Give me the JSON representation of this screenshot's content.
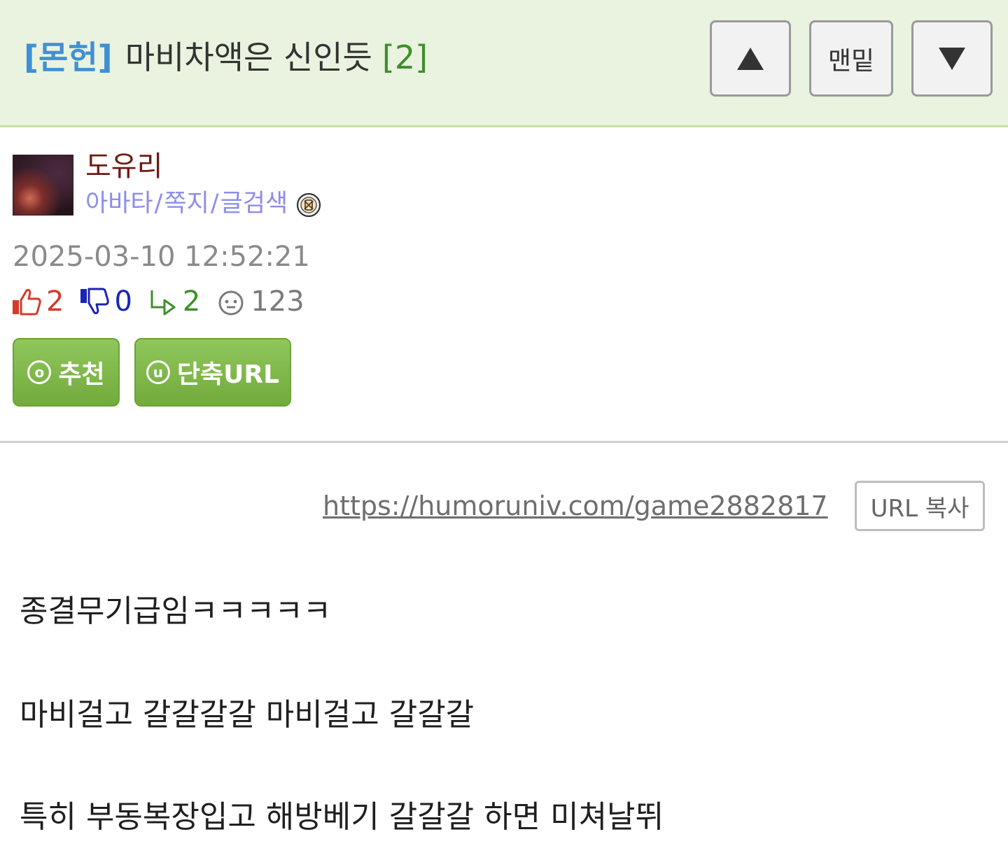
{
  "header": {
    "category": "[몬헌]",
    "subject": "마비차액은 신인듯",
    "comment_count": "[2]",
    "nav_bottom_label": "맨밑",
    "nav_up_icon": "triangle-up-icon",
    "nav_down_icon": "triangle-down-icon"
  },
  "author": {
    "nickname": "도유리",
    "links": {
      "avatar": "아바타",
      "message": "쪽지",
      "search": "글검색",
      "separator": "/"
    },
    "level_icon": "level-badge-icon"
  },
  "post": {
    "datetime": "2025-03-10 12:52:21",
    "stats": {
      "upvotes": "2",
      "downvotes": "0",
      "replies": "2",
      "views": "123"
    },
    "buttons": {
      "recommend": "추천",
      "recommend_icon": "ⓞ",
      "short_url": "단축URL",
      "short_url_icon": "ⓤ"
    },
    "url": "https://humoruniv.com/game2882817",
    "copy_label": "URL 복사",
    "content": [
      "종결무기급임ㅋㅋㅋㅋㅋ",
      "마비걸고 갈갈갈갈 마비걸고 갈갈갈",
      "특히 부동복장입고 해방베기 갈갈갈 하면 미쳐날뛰"
    ]
  },
  "colors": {
    "header_bg": "#e9f3df",
    "category": "#3f8fd6",
    "comment_count": "#3f8f2a",
    "nickname": "#6e1a12",
    "links": "#8c8ee8",
    "upvote": "#d53a2a",
    "downvote": "#1b24b5",
    "reply": "#3f8f2a",
    "button_green": "#7cb546"
  }
}
